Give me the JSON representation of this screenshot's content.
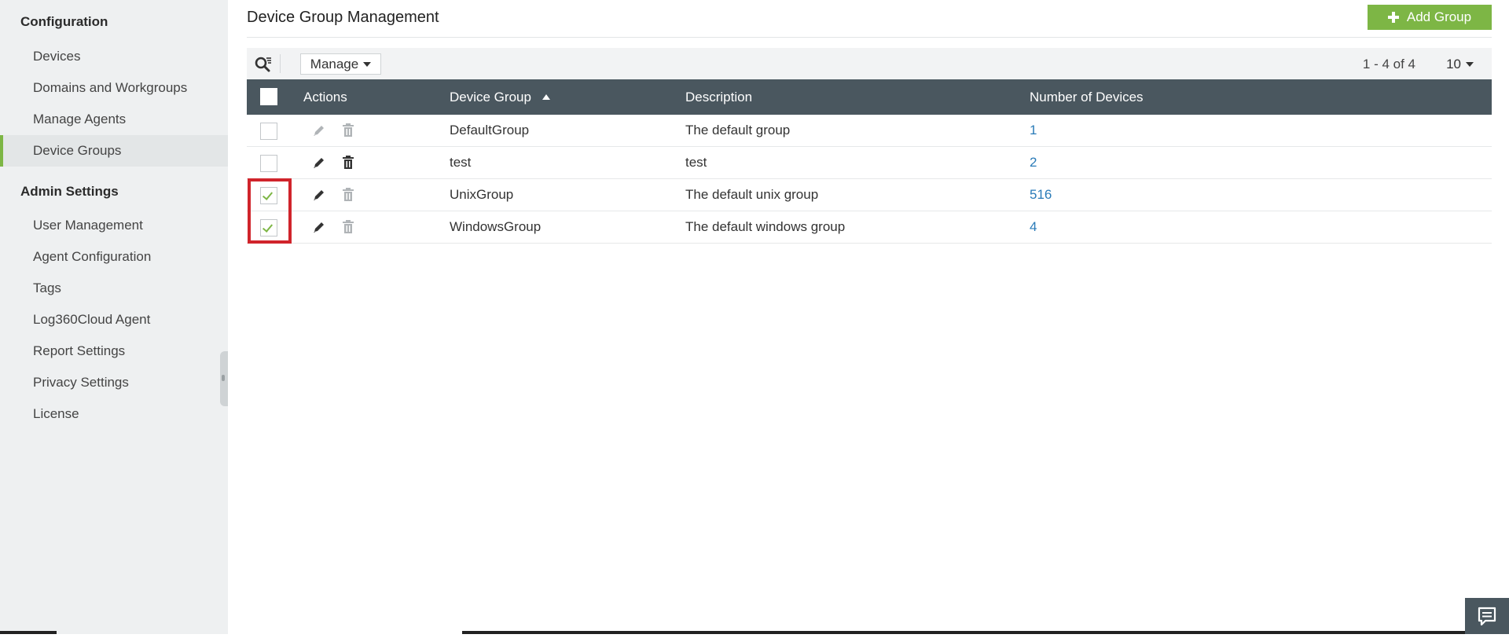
{
  "sidebar": {
    "section_configuration": "Configuration",
    "config_items": [
      "Devices",
      "Domains and Workgroups",
      "Manage Agents",
      "Device Groups"
    ],
    "section_admin": "Admin Settings",
    "admin_items": [
      "User Management",
      "Agent Configuration",
      "Tags",
      "Log360Cloud Agent",
      "Report Settings",
      "Privacy Settings",
      "License"
    ]
  },
  "header": {
    "title": "Device Group Management",
    "add_button": "Add Group"
  },
  "toolbar": {
    "manage_label": "Manage",
    "pager_text": "1 - 4 of 4",
    "page_size": "10"
  },
  "table": {
    "columns": [
      "Actions",
      "Device Group",
      "Description",
      "Number of Devices"
    ],
    "rows": [
      {
        "group": "DefaultGroup",
        "description": "The default group",
        "count": "1",
        "checked": false
      },
      {
        "group": "test",
        "description": "test",
        "count": "2",
        "checked": false
      },
      {
        "group": "UnixGroup",
        "description": "The default unix group",
        "count": "516",
        "checked": true
      },
      {
        "group": "WindowsGroup",
        "description": "The default windows group",
        "count": "4",
        "checked": true
      }
    ]
  },
  "colors": {
    "accent": "#7db645",
    "header_bg": "#4a575f",
    "link": "#2a7bb8",
    "highlight": "#d0242b"
  },
  "icons": [
    "search-filter-icon",
    "caret-down-icon",
    "plus-icon",
    "edit-pencil-icon",
    "trash-icon",
    "checkmark-icon",
    "chat-icon"
  ]
}
